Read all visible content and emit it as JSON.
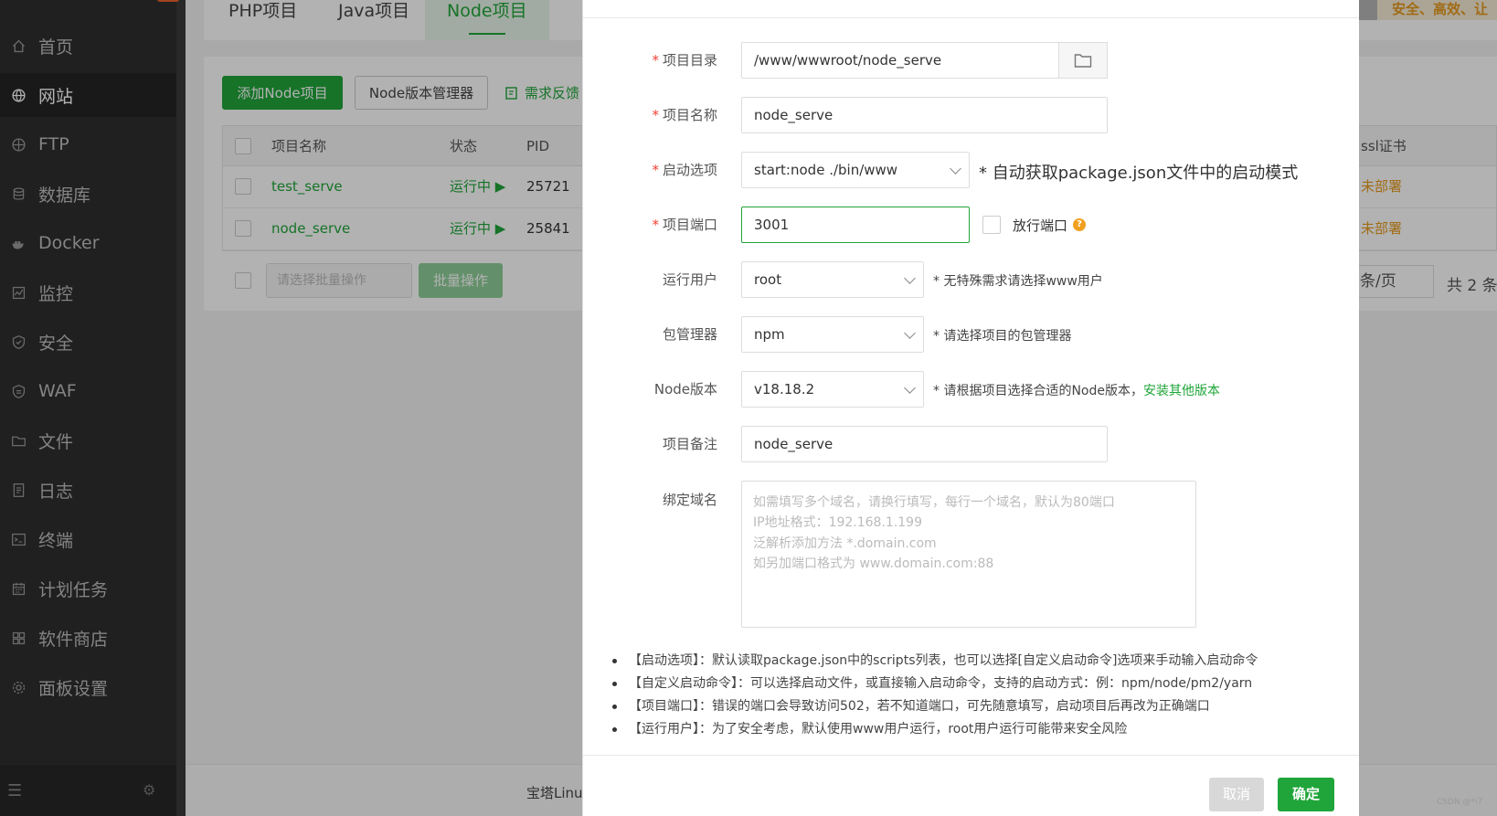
{
  "sidebar": {
    "items": [
      {
        "label": "首页",
        "icon": "home-icon"
      },
      {
        "label": "网站",
        "icon": "globe-icon"
      },
      {
        "label": "FTP",
        "icon": "ftp-icon"
      },
      {
        "label": "数据库",
        "icon": "database-icon"
      },
      {
        "label": "Docker",
        "icon": "docker-icon"
      },
      {
        "label": "监控",
        "icon": "monitor-icon"
      },
      {
        "label": "安全",
        "icon": "shield-icon"
      },
      {
        "label": "WAF",
        "icon": "waf-shield-icon"
      },
      {
        "label": "文件",
        "icon": "folder-icon"
      },
      {
        "label": "日志",
        "icon": "log-icon"
      },
      {
        "label": "终端",
        "icon": "terminal-icon"
      },
      {
        "label": "计划任务",
        "icon": "calendar-icon"
      },
      {
        "label": "软件商店",
        "icon": "apps-icon"
      },
      {
        "label": "面板设置",
        "icon": "gear-icon"
      }
    ],
    "active_index": 1
  },
  "main": {
    "tabs": [
      {
        "label": "PHP项目"
      },
      {
        "label": "Java项目"
      },
      {
        "label": "Node项目",
        "active": true
      }
    ],
    "tagline": "安全、高效、让",
    "toolbar": {
      "add_button": "添加Node项目",
      "version_button": "Node版本管理器",
      "feedback": "需求反馈"
    },
    "table": {
      "headers": {
        "name": "项目名称",
        "status": "状态",
        "pid": "PID",
        "ssl": "ssl证书"
      },
      "rows": [
        {
          "name": "test_serve",
          "status": "运行中 ▶",
          "pid": "25721",
          "ssl": "未部署"
        },
        {
          "name": "node_serve",
          "status": "运行中 ▶",
          "pid": "25841",
          "ssl": "未部署"
        }
      ]
    },
    "footer": {
      "batch_placeholder": "请选择批量操作",
      "batch_button": "批量操作",
      "page_size": "条/页",
      "total": "共 2 条"
    },
    "statusbar_text": "宝塔Linu"
  },
  "modal": {
    "fields": {
      "dir": {
        "label": "项目目录",
        "value": "/www/wwwroot/node_serve"
      },
      "name": {
        "label": "项目名称",
        "value": "node_serve"
      },
      "start": {
        "label": "启动选项",
        "value": "start:node ./bin/www",
        "hint": "* 自动获取package.json文件中的启动模式"
      },
      "port": {
        "label": "项目端口",
        "value": "3001",
        "checkbox_label": "放行端口",
        "help": "?"
      },
      "user": {
        "label": "运行用户",
        "value": "root",
        "hint": "* 无特殊需求请选择www用户"
      },
      "pkg": {
        "label": "包管理器",
        "value": "npm",
        "hint": "* 请选择项目的包管理器"
      },
      "node": {
        "label": "Node版本",
        "value": "v18.18.2",
        "hint": "* 请根据项目选择合适的Node版本，",
        "link": "安装其他版本"
      },
      "remark": {
        "label": "项目备注",
        "value": "node_serve"
      },
      "domain": {
        "label": "绑定域名",
        "placeholder_lines": [
          "如需填写多个域名，请换行填写，每行一个域名，默认为80端口",
          "IP地址格式：192.168.1.199",
          "泛解析添加方法 *.domain.com",
          "如另加端口格式为 www.domain.com:88"
        ]
      }
    },
    "notes": [
      "【启动选项】：默认读取package.json中的scripts列表，也可以选择[自定义启动命令]选项来手动输入启动命令",
      "【自定义启动命令】：可以选择启动文件，或直接输入启动命令，支持的启动方式：例：npm/node/pm2/yarn",
      "【项目端口】：错误的端口会导致访问502，若不知道端口，可先随意填写，启动项目后再改为正确端口",
      "【运行用户】：为了安全考虑，默认使用www用户运行，root用户运行可能带来安全风险"
    ],
    "cancel_button": "取消",
    "ok_button": "确定"
  },
  "watermark": "CSDN @*i7"
}
